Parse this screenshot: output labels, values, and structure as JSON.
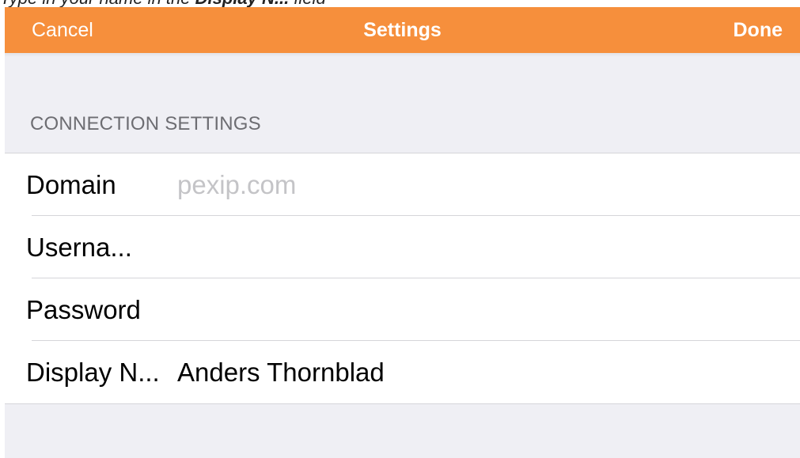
{
  "caption": {
    "text_prefix": "Type in your name in the ",
    "text_emphasis": "Display N...",
    "text_suffix": " field"
  },
  "navbar": {
    "cancel_label": "Cancel",
    "title": "Settings",
    "done_label": "Done",
    "color": "#f68f3c"
  },
  "section": {
    "header": "CONNECTION SETTINGS"
  },
  "fields": {
    "domain": {
      "label": "Domain",
      "value": "",
      "placeholder": "pexip.com"
    },
    "username": {
      "label": "Userna...",
      "value": "",
      "placeholder": ""
    },
    "password": {
      "label": "Password",
      "value": "",
      "placeholder": ""
    },
    "display_name": {
      "label": "Display N...",
      "value": "Anders Thornblad",
      "placeholder": ""
    }
  }
}
